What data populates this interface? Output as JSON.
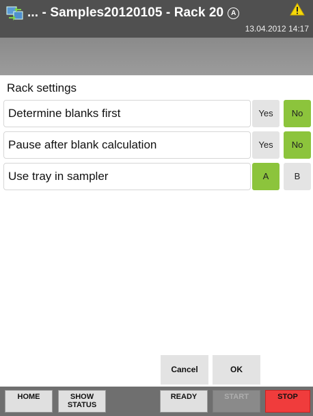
{
  "titlebar": {
    "title": "... - Samples20120105 - Rack 20",
    "auto_symbol": "A",
    "datetime": "13.04.2012 14:17",
    "app_icon": "network-sync-icon",
    "warning_icon": "warning-icon"
  },
  "content": {
    "section_title": "Rack settings",
    "rows": [
      {
        "label": "Determine blanks first",
        "options": [
          "Yes",
          "No"
        ],
        "selected": "No"
      },
      {
        "label": "Pause after blank calculation",
        "options": [
          "Yes",
          "No"
        ],
        "selected": "No"
      },
      {
        "label": "Use tray in sampler",
        "options": [
          "A",
          "B"
        ],
        "selected": "A"
      }
    ],
    "cancel_label": "Cancel",
    "ok_label": "OK"
  },
  "bottombar": {
    "home_label": "HOME",
    "show_status_label_1": "SHOW",
    "show_status_label_2": "STATUS",
    "ready_label": "READY",
    "start_label": "START",
    "stop_label": "STOP"
  },
  "colors": {
    "selected": "#8cc43c",
    "unselected": "#e4e4e4",
    "stop": "#f03c3c",
    "titlebar": "#505050"
  }
}
